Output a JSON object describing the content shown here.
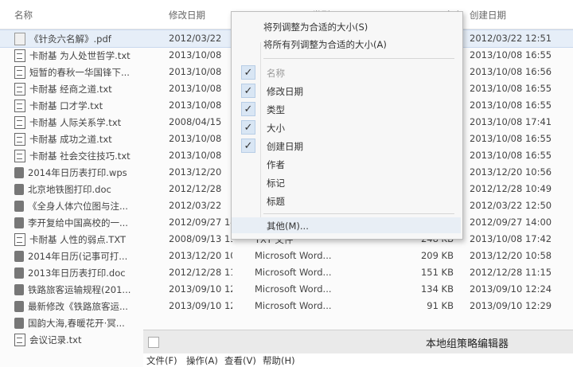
{
  "columns": {
    "name": "名称",
    "modified": "修改日期",
    "type": "类型",
    "size": "大小",
    "created": "创建日期"
  },
  "files": [
    {
      "name": "《针灸六名解》.pdf",
      "modified": "2012/03/22",
      "type": "",
      "size": "",
      "created": "2012/03/22 12:51",
      "icon": "pdf-icon"
    },
    {
      "name": "卡耐基 为人处世哲学.txt",
      "modified": "2013/10/08",
      "type": "",
      "size": "",
      "created": "2013/10/08 16:55",
      "icon": "text-file-icon"
    },
    {
      "name": "短暂的春秋一华国锋下...",
      "modified": "2013/10/08",
      "type": "",
      "size": "",
      "created": "2013/10/08 16:56",
      "icon": "text-file-icon"
    },
    {
      "name": "卡耐基 经商之道.txt",
      "modified": "2013/10/08",
      "type": "",
      "size": "",
      "created": "2013/10/08 16:55",
      "icon": "text-file-icon"
    },
    {
      "name": "卡耐基 口才学.txt",
      "modified": "2013/10/08",
      "type": "",
      "size": "",
      "created": "2013/10/08 16:55",
      "icon": "text-file-icon"
    },
    {
      "name": "卡耐基 人际关系学.txt",
      "modified": "2008/04/15",
      "type": "",
      "size": "",
      "created": "2013/10/08 17:41",
      "icon": "text-file-icon"
    },
    {
      "name": "卡耐基 成功之道.txt",
      "modified": "2013/10/08",
      "type": "",
      "size": "",
      "created": "2013/10/08 16:55",
      "icon": "text-file-icon"
    },
    {
      "name": "卡耐基 社会交往技巧.txt",
      "modified": "2013/10/08",
      "type": "",
      "size": "",
      "created": "2013/10/08 16:55",
      "icon": "text-file-icon"
    },
    {
      "name": "2014年日历表打印.wps",
      "modified": "2013/12/20",
      "type": "",
      "size": "",
      "created": "2013/12/20 10:56",
      "icon": "wps-doc-icon"
    },
    {
      "name": "北京地铁图打印.doc",
      "modified": "2012/12/28",
      "type": "",
      "size": "",
      "created": "2012/12/28 10:49",
      "icon": "word-doc-icon"
    },
    {
      "name": "《全身人体穴位图与注...",
      "modified": "2012/03/22",
      "type": "",
      "size": "",
      "created": "2012/03/22 12:50",
      "icon": "word-doc-icon"
    },
    {
      "name": "李开复给中国高校的一...",
      "modified": "2012/09/27 14:00",
      "type": "Microsoft Word...",
      "size": "248 KB",
      "created": "2012/09/27 14:00",
      "icon": "word-doc-icon"
    },
    {
      "name": "卡耐基 人性的弱点.TXT",
      "modified": "2008/09/13 13:27",
      "type": "TXT 文件",
      "size": "248 KB",
      "created": "2013/10/08 17:42",
      "icon": "text-file-icon"
    },
    {
      "name": "2014年日历(记事可打...",
      "modified": "2013/12/20 10:58",
      "type": "Microsoft Word...",
      "size": "209 KB",
      "created": "2013/12/20 10:58",
      "icon": "word-doc-icon"
    },
    {
      "name": "2013年日历表打印.doc",
      "modified": "2012/12/28 11:15",
      "type": "Microsoft Word...",
      "size": "151 KB",
      "created": "2012/12/28 11:15",
      "icon": "word-doc-icon"
    },
    {
      "name": "铁路旅客运输规程(201...",
      "modified": "2013/09/10 12:24",
      "type": "Microsoft Word...",
      "size": "134 KB",
      "created": "2013/09/10 12:24",
      "icon": "word-doc-icon"
    },
    {
      "name": "最新修改《铁路旅客运...",
      "modified": "2013/09/10 12:29",
      "type": "Microsoft Word...",
      "size": "91 KB",
      "created": "2013/09/10 12:29",
      "icon": "word-doc-icon"
    },
    {
      "name": "国韵大海,春暖花开·冥...",
      "modified": "",
      "type": "",
      "size": "",
      "created": "",
      "icon": "word-doc-icon"
    },
    {
      "name": "会议记录.txt",
      "modified": "",
      "type": "",
      "size": "",
      "created": "",
      "icon": "text-file-icon"
    }
  ],
  "context_menu": {
    "fit_column": "将列调整为合适的大小(S)",
    "fit_all": "将所有列调整为合适的大小(A)",
    "items": [
      {
        "label": "名称",
        "checked": true,
        "disabled": true
      },
      {
        "label": "修改日期",
        "checked": true
      },
      {
        "label": "类型",
        "checked": true
      },
      {
        "label": "大小",
        "checked": true
      },
      {
        "label": "创建日期",
        "checked": true
      },
      {
        "label": "作者",
        "checked": false
      },
      {
        "label": "标记",
        "checked": false
      },
      {
        "label": "标题",
        "checked": false
      }
    ],
    "more": "其他(M)..."
  },
  "policy_window": {
    "title": "本地组策略编辑器",
    "menu": [
      "文件(F)",
      "操作(A)",
      "查看(V)",
      "帮助(H)"
    ]
  },
  "colors": {
    "selection": "#e6eef8",
    "menu_bg": "#f7f7f7",
    "check_bg": "#d9e6f4"
  }
}
